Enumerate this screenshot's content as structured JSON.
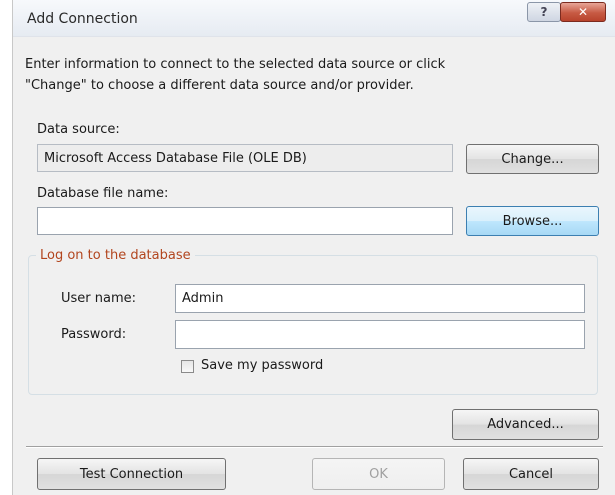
{
  "window": {
    "title": "Add Connection",
    "help_label": "?",
    "close_label": "✕"
  },
  "description": "Enter information to connect to the selected data source or click\n\"Change\" to choose a different data source and/or provider.",
  "data_source": {
    "label": "Data source:",
    "value": "Microsoft Access Database File (OLE DB)",
    "change_label": "Change..."
  },
  "database_file": {
    "label": "Database file name:",
    "value": "",
    "browse_label": "Browse..."
  },
  "logon": {
    "legend": "Log on to the database",
    "user_name_label": "User name:",
    "user_name_value": "Admin",
    "password_label": "Password:",
    "password_value": "",
    "save_password_label": "Save my password",
    "save_password_checked": false
  },
  "buttons": {
    "advanced": "Advanced...",
    "test_connection": "Test Connection",
    "ok": "OK",
    "cancel": "Cancel"
  },
  "colors": {
    "legend_text": "#b2451e",
    "close_button": "#c75a44",
    "window_bg": "#f0f0f0"
  }
}
